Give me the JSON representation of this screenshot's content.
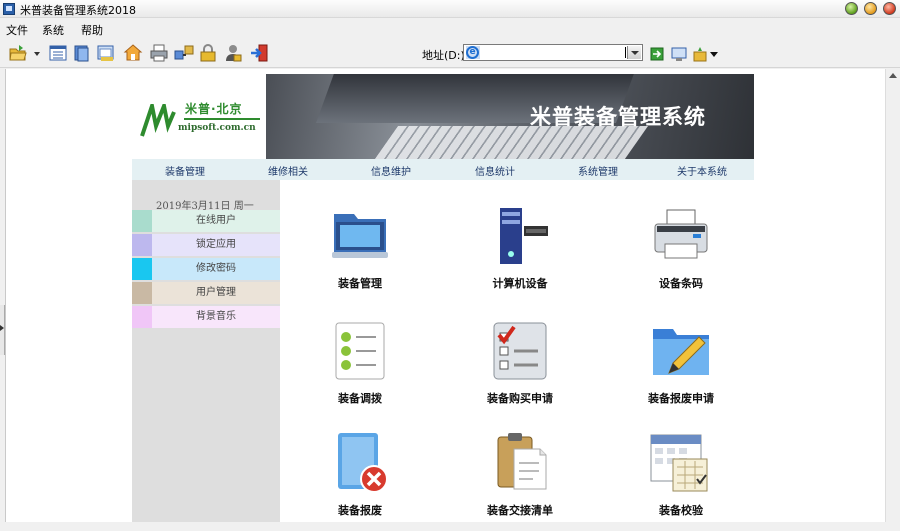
{
  "window": {
    "title": "米普装备管理系统2018"
  },
  "menu": [
    "文件",
    "系统",
    "帮助"
  ],
  "address": {
    "label": "地址(D:)",
    "value": ""
  },
  "banner": {
    "logo_name": "米普·北京",
    "logo_url": "mipsoft.com.cn",
    "title": "米普装备管理系统"
  },
  "nav": [
    "装备管理",
    "维修相关",
    "信息维护",
    "信息统计",
    "系统管理",
    "关于本系统"
  ],
  "sidebar": {
    "date": "2019年3月11日  周一",
    "items": [
      {
        "label": "在线用户",
        "swatch": "#a9dccd",
        "bg": "#dff2ea"
      },
      {
        "label": "锁定应用",
        "swatch": "#bdb8ee",
        "bg": "#e6e3fa"
      },
      {
        "label": "修改密码",
        "swatch": "#19c7f0",
        "bg": "#c8e8fa"
      },
      {
        "label": "用户管理",
        "swatch": "#c9b9a4",
        "bg": "#ebe3d8"
      },
      {
        "label": "背景音乐",
        "swatch": "#f0c6f7",
        "bg": "#f8e6fb"
      }
    ]
  },
  "apps": [
    {
      "label": "装备管理",
      "icon": "folder-laptop-icon"
    },
    {
      "label": "计算机设备",
      "icon": "server-icon"
    },
    {
      "label": "设备条码",
      "icon": "printer-icon"
    },
    {
      "label": "装备调拨",
      "icon": "checklist-icon"
    },
    {
      "label": "装备购买申请",
      "icon": "checkbox-form-icon"
    },
    {
      "label": "装备报废申请",
      "icon": "folder-pencil-icon"
    },
    {
      "label": "装备报废",
      "icon": "delete-document-icon"
    },
    {
      "label": "装备交接清单",
      "icon": "clipboard-icon"
    },
    {
      "label": "装备校验",
      "icon": "calendar-icon"
    }
  ],
  "colors": {
    "accent": "#2e8b2e",
    "nav_bg": "#e4f0f3",
    "sidebar_bg": "#dedede"
  }
}
